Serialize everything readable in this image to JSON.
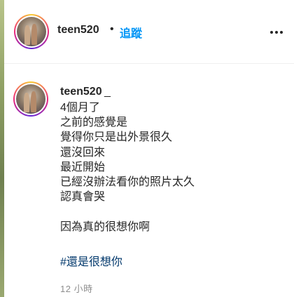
{
  "header": {
    "username": "teen520",
    "separator": "•",
    "follow_label": "追蹤"
  },
  "caption": {
    "username": "teen520",
    "username_suffix": "_",
    "lines": [
      "4個月了",
      "之前的感覺是",
      "覺得你只是出外景很久",
      "還沒回來",
      "最近開始",
      "已經沒辦法看你的照片太久",
      "認真會哭",
      "",
      "因為真的很想你啊"
    ],
    "hashtag": "#還是很想你",
    "timestamp": "12 小時"
  },
  "icons": {
    "more": "more-options-icon",
    "avatar": "profile-avatar"
  },
  "colors": {
    "link_blue": "#0095f6",
    "hashtag": "#00376b",
    "muted": "#8e8e8e"
  }
}
